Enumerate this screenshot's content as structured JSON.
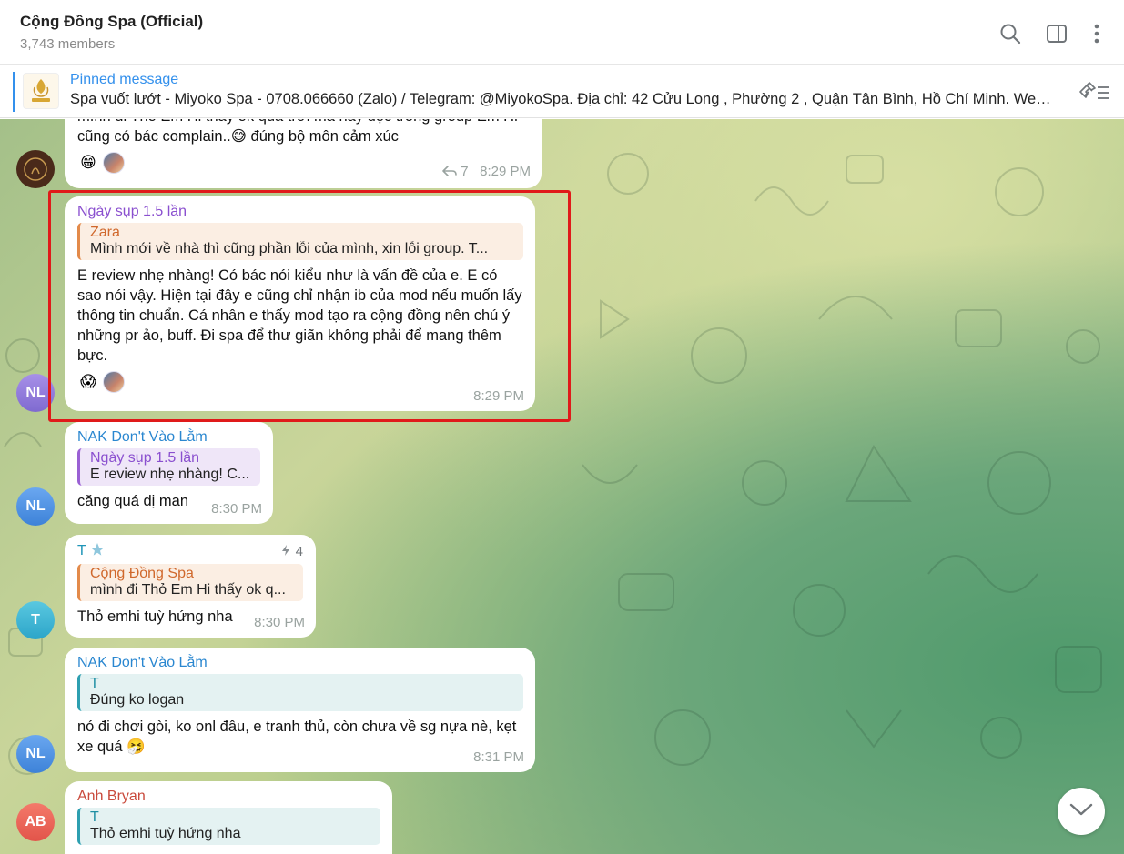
{
  "header": {
    "title": "Cộng Đồng Spa (Official)",
    "members": "3,743 members"
  },
  "pinned": {
    "label": "Pinned message",
    "text": "Spa vuốt lướt  - Miyoko Spa - 0708.066660 (Zalo) / Telegram: @MiyokoSpa.  Địa chỉ: 42 Cửu Long , Phường 2 , Quận Tân Bình, Hồ Chí Minh. Websi..."
  },
  "messages": {
    "m0": {
      "line1": "mình đi Thỏ Em Hi thấy ok quá trời mà hay đọc trong group Em Hi",
      "line2": "cũng có bác complain..😅 đúng bộ môn cảm xúc",
      "reaction1": "😁",
      "replies": "7",
      "time": "8:29 PM"
    },
    "m1": {
      "sender": "Ngày sụp 1.5 lần",
      "reply_name": "Zara",
      "reply_text": "Mình mới về nhà thì cũng phần lỗi của mình, xin lỗi group. T...",
      "text": "E review nhẹ nhàng! Có bác nói kiểu như là vấn đề của e. E có sao nói vậy. Hiện tại đây e cũng chỉ nhận ib của mod nếu muốn lấy thông tin chuẩn. Cá nhân e thấy mod tạo ra cộng đồng nên chú ý những pr ảo, buff. Đi spa để thư giãn không phải để mang thêm bực.",
      "reaction1": "😱",
      "time": "8:29 PM",
      "avatar": "NL"
    },
    "m2": {
      "sender": "NAK Don't Vào Lằm",
      "reply_name": "Ngày sụp 1.5 lần",
      "reply_text": "E review nhẹ nhàng! C...",
      "text": "căng quá dị man",
      "time": "8:30 PM",
      "avatar": "NL"
    },
    "m3": {
      "sender": "T",
      "boosts": "4",
      "reply_name": "Cộng Đồng Spa",
      "reply_text": "mình đi Thỏ Em Hi thấy ok q...",
      "text": "Thỏ emhi tuỳ hứng nha",
      "time": "8:30 PM",
      "avatar": "T"
    },
    "m4": {
      "sender": "NAK Don't Vào Lằm",
      "reply_name": "T",
      "reply_text": "Đúng ko logan",
      "text": "nó đi chơi gòi, ko onl đâu, e tranh thủ, còn chưa về sg nựa nè, kẹt xe quá 🤧",
      "time": "8:31 PM",
      "avatar": "NL"
    },
    "m5": {
      "sender": "Anh Bryan",
      "reply_name": "T",
      "reply_text": "Thỏ emhi tuỳ hứng nha",
      "avatar": "AB"
    }
  },
  "colors": {
    "accent": "#3390ec",
    "highlight": "#e01a1a",
    "sender_purple": "#8a4fcf",
    "sender_blue": "#2a87d0",
    "sender_teal": "#1f95b8",
    "sender_red": "#c94a3c"
  },
  "icons": [
    "search-icon",
    "sidebar-toggle-icon",
    "more-vertical-icon",
    "pin-list-icon",
    "reply-arrow-icon",
    "star-icon",
    "boost-icon",
    "chevron-down-icon"
  ]
}
